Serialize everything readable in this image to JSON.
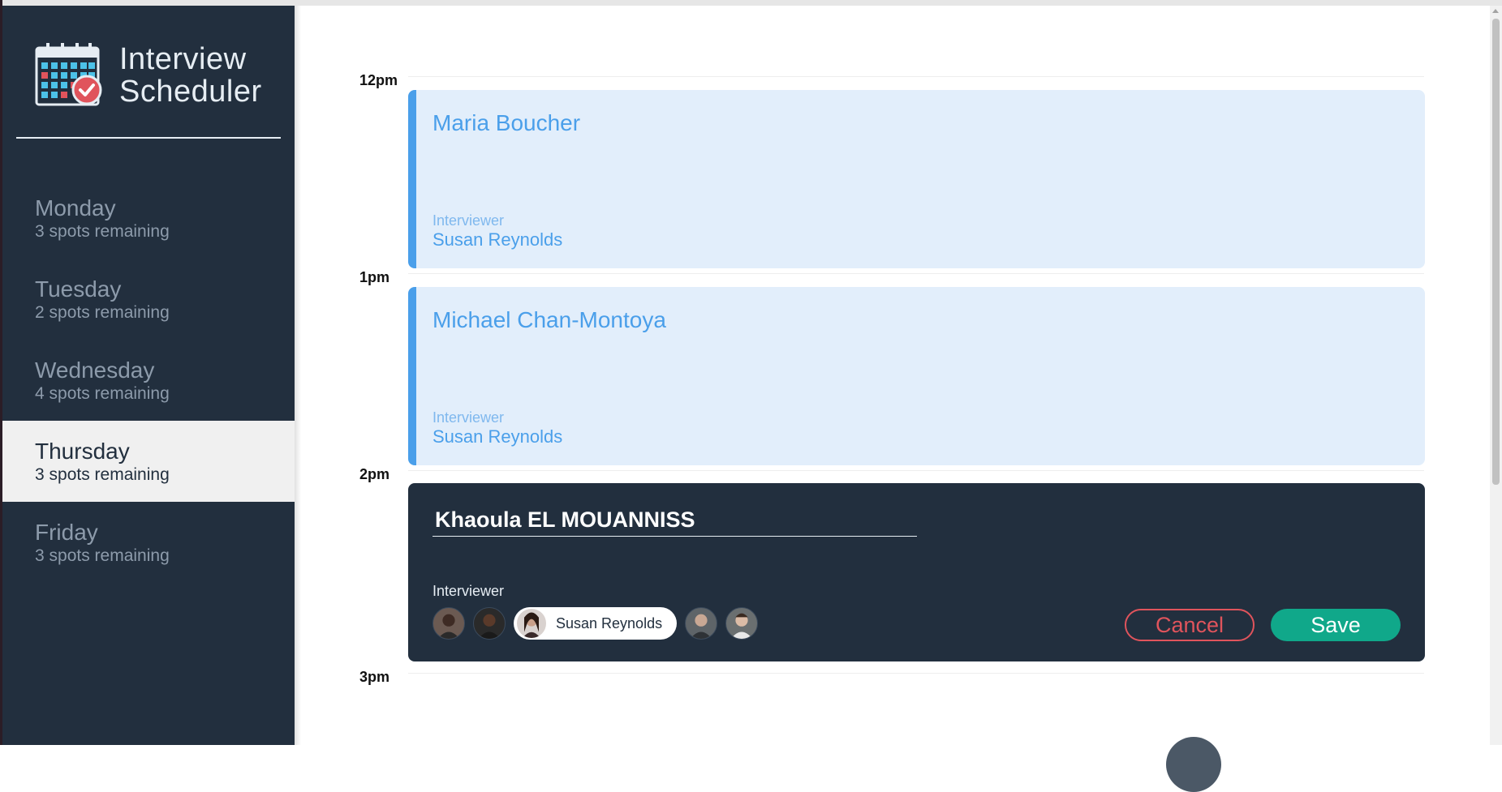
{
  "app": {
    "title_line1": "Interview",
    "title_line2": "Scheduler",
    "logo_icon": "calendar-check-icon"
  },
  "sidebar": {
    "days": [
      {
        "name": "Monday",
        "spots": "3 spots remaining",
        "selected": false
      },
      {
        "name": "Tuesday",
        "spots": "2 spots remaining",
        "selected": false
      },
      {
        "name": "Wednesday",
        "spots": "4 spots remaining",
        "selected": false
      },
      {
        "name": "Thursday",
        "spots": "3 spots remaining",
        "selected": true
      },
      {
        "name": "Friday",
        "spots": "3 spots remaining",
        "selected": false
      }
    ]
  },
  "schedule": {
    "times": [
      "12pm",
      "1pm",
      "2pm",
      "3pm"
    ],
    "appointments": [
      {
        "student": "Maria Boucher",
        "interviewer_label": "Interviewer",
        "interviewer": "Susan Reynolds"
      },
      {
        "student": "Michael Chan-Montoya",
        "interviewer_label": "Interviewer",
        "interviewer": "Susan Reynolds"
      }
    ],
    "form": {
      "student_value": "Khaoula EL MOUANNISS",
      "interviewer_label": "Interviewer",
      "selected_interviewer": "Susan Reynolds",
      "cancel_label": "Cancel",
      "save_label": "Save"
    }
  },
  "colors": {
    "sidebar_bg": "#222f3e",
    "accent_blue": "#4a9fea",
    "appointment_bg": "#e2eefb",
    "danger": "#e0545c",
    "success": "#10a88a"
  }
}
